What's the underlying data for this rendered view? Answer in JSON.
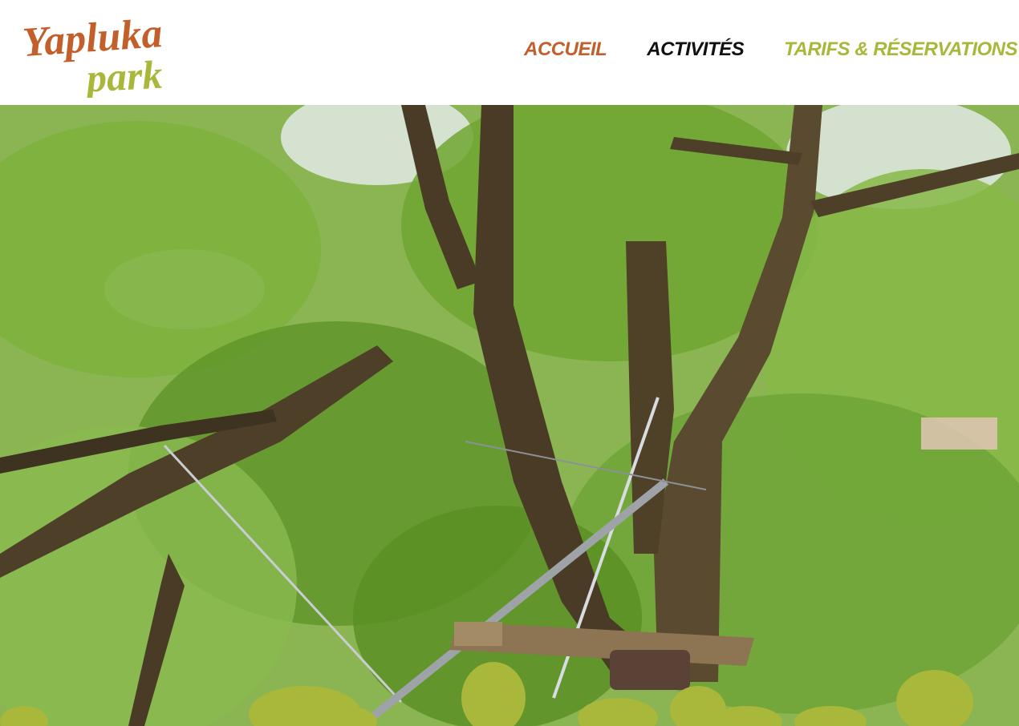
{
  "brand": {
    "logo_line1": "Yapluka",
    "logo_line2": "park",
    "logo_color_primary": "#c25f2a",
    "logo_color_secondary": "#a9b73a"
  },
  "nav": {
    "items": [
      {
        "label": "ACCUEIL",
        "color": "#c25f2a"
      },
      {
        "label": "ACTIVITÉS",
        "color": "#111111"
      },
      {
        "label": "TARIFS & RÉSERVATIONS",
        "color": "#a9b73a"
      }
    ]
  },
  "hero": {
    "icon": "treetop-zipline-photo",
    "accent_bush_color": "#a9b73a"
  }
}
